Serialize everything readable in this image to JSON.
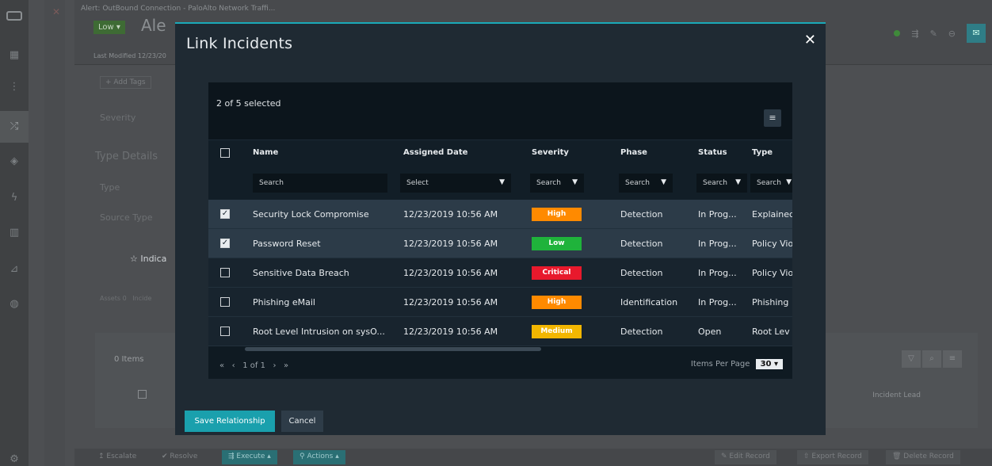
{
  "background": {
    "record_small_title": "Alert: OutBound Connection - PaloAlto Network Traffi...",
    "severity_badge": "Low",
    "record_title_fragment": "Ale",
    "last_modified": "Last Modified 12/23/20",
    "add_tags": "+ Add Tags",
    "labels": {
      "severity": "Severity",
      "type_details": "Type Details",
      "type": "Type",
      "source_type": "Source Type"
    },
    "indicators_tab": "Indica",
    "assets_tab": "Assets 0",
    "incidents_tab": "Incide",
    "items_count": "0 Items",
    "incident_lead_col": "Incident Lead",
    "bottom_actions": {
      "escalate": "Escalate",
      "resolve": "Resolve",
      "execute": "Execute",
      "actions": "Actions",
      "edit_record": "Edit Record",
      "export_record": "Export Record",
      "delete_record": "Delete Record"
    }
  },
  "modal": {
    "title": "Link Incidents",
    "close_symbol": "✕",
    "selection_summary": "2 of 5 selected",
    "columns": {
      "name": "Name",
      "assigned_date": "Assigned Date",
      "severity": "Severity",
      "phase": "Phase",
      "status": "Status",
      "type": "Type"
    },
    "filters": {
      "name": "Search",
      "assigned_date": "Select",
      "severity": "Search",
      "phase": "Search",
      "status": "Search",
      "type": "Search"
    },
    "rows": [
      {
        "selected": true,
        "name": "Security Lock Compromise",
        "date": "12/23/2019 10:56 AM",
        "severity": "High",
        "severity_color": "#ff8a00",
        "phase": "Detection",
        "status": "In Prog...",
        "type": "Explained"
      },
      {
        "selected": true,
        "name": "Password Reset",
        "date": "12/23/2019 10:56 AM",
        "severity": "Low",
        "severity_color": "#1fb33b",
        "phase": "Detection",
        "status": "In Prog...",
        "type": "Policy Vio"
      },
      {
        "selected": false,
        "name": "Sensitive Data Breach",
        "date": "12/23/2019 10:56 AM",
        "severity": "Critical",
        "severity_color": "#e8192c",
        "phase": "Detection",
        "status": "In Prog...",
        "type": "Policy Vio"
      },
      {
        "selected": false,
        "name": "Phishing eMail",
        "date": "12/23/2019 10:56 AM",
        "severity": "High",
        "severity_color": "#ff8a00",
        "phase": "Identification",
        "status": "In Prog...",
        "type": "Phishing"
      },
      {
        "selected": false,
        "name": "Root Level Intrusion on sysO...",
        "date": "12/23/2019 10:56 AM",
        "severity": "Medium",
        "severity_color": "#f2b600",
        "phase": "Detection",
        "status": "Open",
        "type": "Root Lev"
      }
    ],
    "pager": {
      "first": "«",
      "prev": "‹",
      "page_text": "1 of 1",
      "next": "›",
      "last": "»"
    },
    "items_per_page_label": "Items Per Page",
    "items_per_page_value": "30",
    "save_label": "Save Relationship",
    "cancel_label": "Cancel"
  }
}
